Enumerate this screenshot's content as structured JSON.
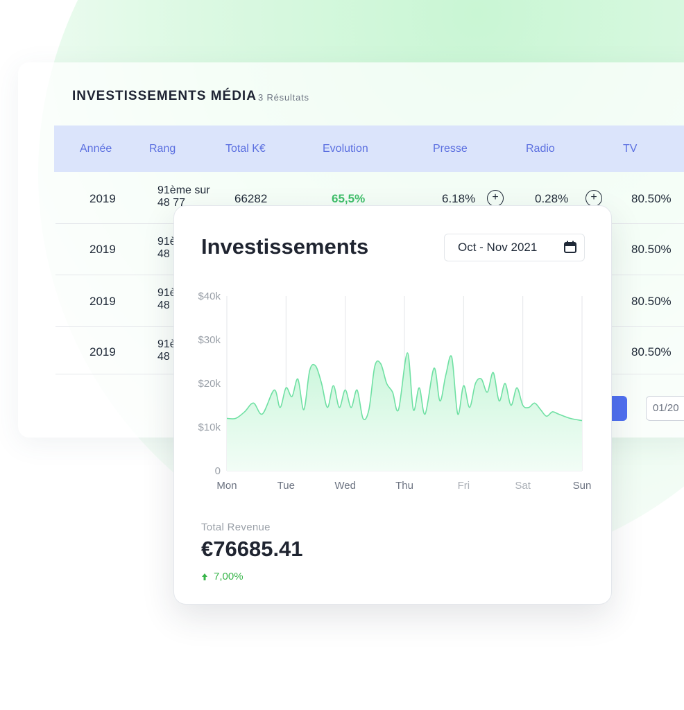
{
  "media": {
    "title": "INVESTISSEMENTS MÉDIA",
    "results": "3 Résultats",
    "columns": [
      "Année",
      "Rang",
      "Total K€",
      "Evolution",
      "Presse",
      "Radio",
      "TV"
    ],
    "rows": [
      {
        "year": "2019",
        "rank_line1": "91ème sur",
        "rank_line2": "48 77",
        "total": "66282",
        "evolution": "65,5%",
        "presse": "6.18%",
        "radio": "0.28%",
        "tv": "80.50%"
      },
      {
        "year": "2019",
        "rank_line1": "91è",
        "rank_line2": "48",
        "tv": "80.50%"
      },
      {
        "year": "2019",
        "rank_line1": "91è",
        "rank_line2": "48",
        "tv": "80.50%"
      },
      {
        "year": "2019",
        "rank_line1": "91è",
        "rank_line2": "48",
        "tv": "80.50%"
      }
    ],
    "pager": "01/20"
  },
  "investments": {
    "title": "Investissements",
    "date_range": "Oct - Nov 2021",
    "total_label": "Total Revenue",
    "total_value": "€76685.41",
    "trend": "7,00%"
  },
  "colors": {
    "accent_blue": "#5b6fe0",
    "header_bg": "#dbe4fb",
    "positive_green": "#3fbf6a",
    "chart_line": "#6fe0a3",
    "chart_fill": "#d6f8e3"
  },
  "icons": {
    "calendar": "calendar-icon",
    "plus": "plus-circle-icon",
    "trend": "arrow-up-icon"
  },
  "chart_data": {
    "type": "area",
    "title": "",
    "xlabel": "",
    "ylabel": "",
    "x_ticks": [
      "Mon",
      "Tue",
      "Wed",
      "Thu",
      "Fri",
      "Sat",
      "Sun"
    ],
    "y_ticks": [
      "0",
      "$10k",
      "$20k",
      "$30k",
      "$40k"
    ],
    "ylim": [
      0,
      40000
    ],
    "grid": "vertical",
    "series": [
      {
        "values": [
          [
            0,
            12000
          ],
          [
            0.15,
            12000
          ],
          [
            0.3,
            13500
          ],
          [
            0.45,
            15500
          ],
          [
            0.6,
            13000
          ],
          [
            0.8,
            18500
          ],
          [
            0.9,
            14500
          ],
          [
            1.0,
            19000
          ],
          [
            1.1,
            17000
          ],
          [
            1.2,
            21000
          ],
          [
            1.3,
            14000
          ],
          [
            1.4,
            23000
          ],
          [
            1.5,
            24000
          ],
          [
            1.6,
            20000
          ],
          [
            1.7,
            14500
          ],
          [
            1.8,
            19500
          ],
          [
            1.9,
            14500
          ],
          [
            2.0,
            18500
          ],
          [
            2.1,
            14500
          ],
          [
            2.2,
            18500
          ],
          [
            2.3,
            12000
          ],
          [
            2.4,
            14000
          ],
          [
            2.5,
            24000
          ],
          [
            2.6,
            24500
          ],
          [
            2.7,
            20000
          ],
          [
            2.8,
            18000
          ],
          [
            2.9,
            14000
          ],
          [
            3.05,
            27000
          ],
          [
            3.15,
            14000
          ],
          [
            3.25,
            19000
          ],
          [
            3.35,
            13000
          ],
          [
            3.5,
            23500
          ],
          [
            3.6,
            16000
          ],
          [
            3.7,
            22000
          ],
          [
            3.8,
            26000
          ],
          [
            3.9,
            13000
          ],
          [
            4.0,
            19500
          ],
          [
            4.1,
            14500
          ],
          [
            4.2,
            20000
          ],
          [
            4.3,
            21000
          ],
          [
            4.4,
            18000
          ],
          [
            4.5,
            22500
          ],
          [
            4.6,
            16000
          ],
          [
            4.7,
            20000
          ],
          [
            4.8,
            15000
          ],
          [
            4.9,
            19000
          ],
          [
            5.0,
            15000
          ],
          [
            5.1,
            14500
          ],
          [
            5.2,
            15500
          ],
          [
            5.3,
            14000
          ],
          [
            5.4,
            12500
          ],
          [
            5.5,
            13500
          ],
          [
            5.6,
            13000
          ],
          [
            5.8,
            12000
          ],
          [
            6.0,
            11500
          ]
        ]
      }
    ]
  }
}
